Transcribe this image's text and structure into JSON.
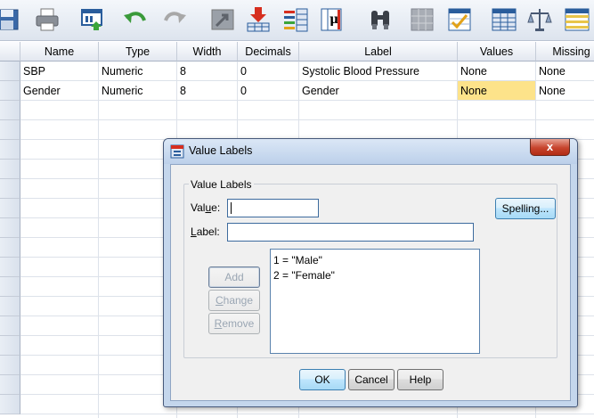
{
  "toolbar": {
    "icons": [
      "save-icon",
      "print-icon",
      "recall-dialog-icon",
      "undo-icon",
      "redo-icon",
      "goto-case-icon",
      "goto-variable-icon",
      "variables-icon",
      "descriptive-stats-icon",
      "find-icon",
      "split-file-icon",
      "weight-cases-icon",
      "select-cases-icon",
      "value-labels-icon",
      "use-sets-icon"
    ]
  },
  "grid": {
    "columns": [
      "Name",
      "Type",
      "Width",
      "Decimals",
      "Label",
      "Values",
      "Missing"
    ],
    "rows": [
      {
        "name": "SBP",
        "type": "Numeric",
        "width": "8",
        "decimals": "0",
        "label": "Systolic Blood Pressure",
        "values": "None",
        "missing": "None"
      },
      {
        "name": "Gender",
        "type": "Numeric",
        "width": "8",
        "decimals": "0",
        "label": "Gender",
        "values": "None",
        "missing": "None"
      }
    ]
  },
  "dialog": {
    "title": "Value Labels",
    "group_label": "Value Labels",
    "value_label_pre": "Val",
    "value_label_u": "u",
    "value_label_post": "e:",
    "label_label_u": "L",
    "label_label_post": "abel:",
    "value_input": "",
    "label_input": "",
    "spelling_button": "Spelling...",
    "add_button": "Add",
    "change_button": "Change",
    "remove_button_u": "R",
    "remove_button_post": "emove",
    "list_items": [
      "1 = \"Male\"",
      "2 = \"Female\""
    ],
    "ok_button": "OK",
    "cancel_button": "Cancel",
    "help_button": "Help",
    "close_glyph": "x"
  },
  "colors": {
    "highlight": "#fde38a",
    "dialog_frame": "#c4d6ec",
    "close_button": "#c7442d"
  }
}
